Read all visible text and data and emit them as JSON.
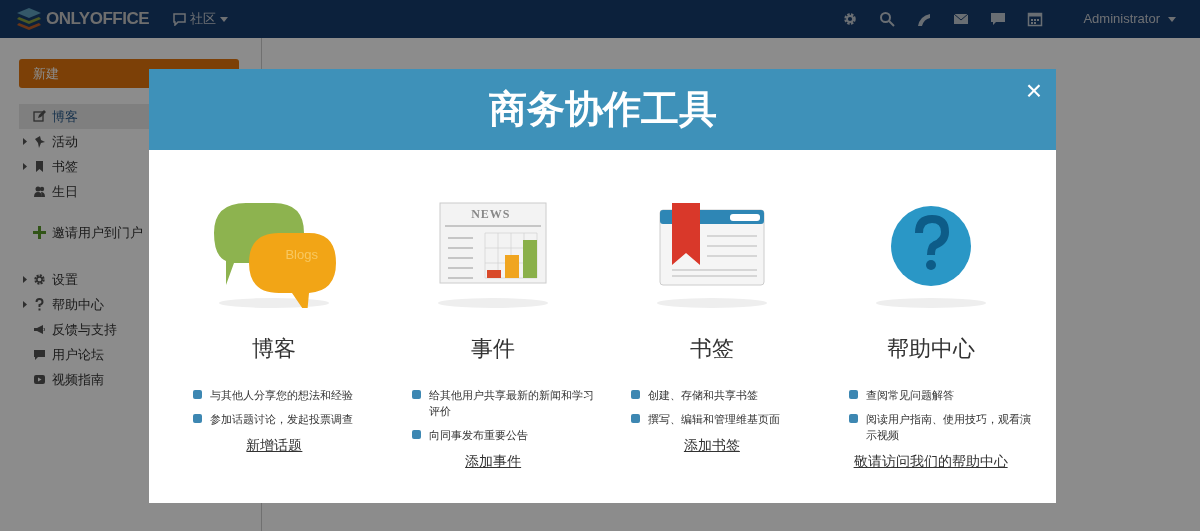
{
  "header": {
    "logo": "ONLYOFFICE",
    "module": "社区",
    "user": "Administrator"
  },
  "sidebar": {
    "new_button": "新建",
    "items": [
      {
        "label": "博客",
        "selected": true,
        "has_children": false
      },
      {
        "label": "活动",
        "selected": false,
        "has_children": true
      },
      {
        "label": "书签",
        "selected": false,
        "has_children": true
      },
      {
        "label": "生日",
        "selected": false,
        "has_children": false
      }
    ],
    "invite": "邀请用户到门户",
    "bottom_items": [
      {
        "label": "设置",
        "has_children": true
      },
      {
        "label": "帮助中心",
        "has_children": true
      },
      {
        "label": "反馈与支持",
        "has_children": false
      },
      {
        "label": "用户论坛",
        "has_children": false
      },
      {
        "label": "视频指南",
        "has_children": false
      }
    ]
  },
  "modal": {
    "title": "商务协作工具",
    "close": "×",
    "features": [
      {
        "title": "博客",
        "icon_text": "Blogs",
        "bullets": [
          "与其他人分享您的想法和经验",
          "参加话题讨论，发起投票调查"
        ],
        "link": "新增话题"
      },
      {
        "title": "事件",
        "icon_text": "NEWS",
        "bullets": [
          "给其他用户共享最新的新闻和学习评价",
          "向同事发布重要公告"
        ],
        "link": "添加事件"
      },
      {
        "title": "书签",
        "bullets": [
          "创建、存储和共享书签",
          "撰写、编辑和管理维基页面"
        ],
        "link": "添加书签"
      },
      {
        "title": "帮助中心",
        "bullets": [
          "查阅常见问题解答",
          "阅读用户指南、使用技巧，观看演示视频"
        ],
        "link": "敬请访问我们的帮助中心"
      }
    ]
  }
}
